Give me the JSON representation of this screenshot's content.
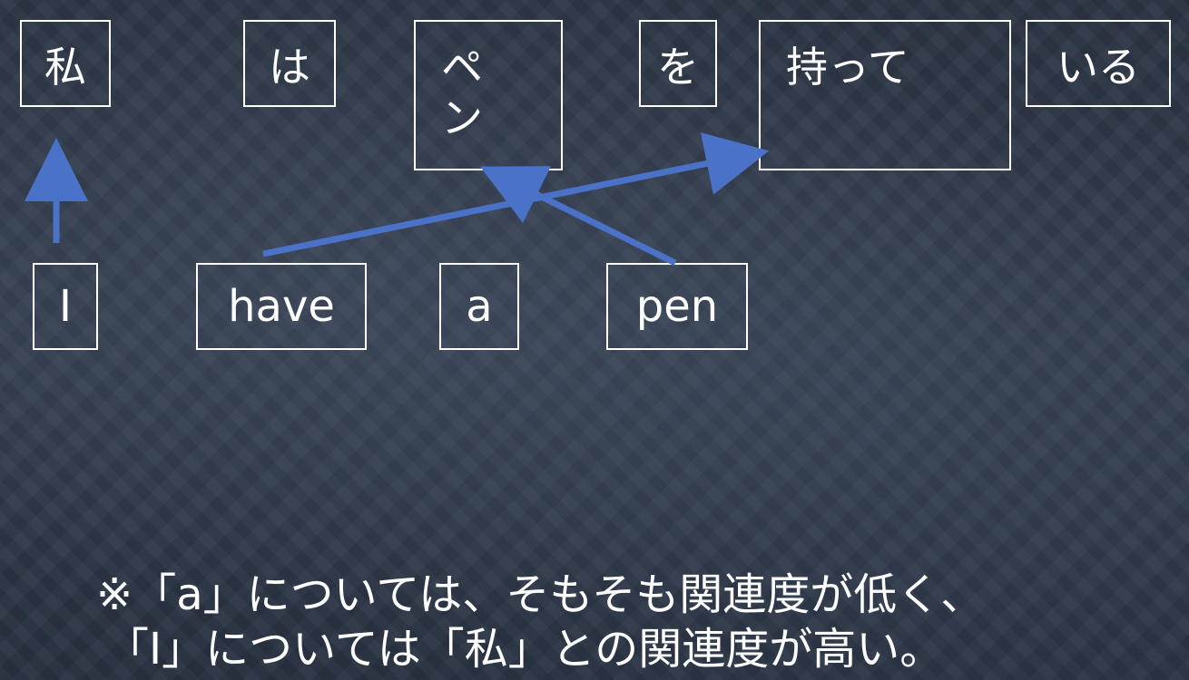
{
  "japanese_words": [
    "私",
    "は",
    "ペン",
    "を",
    "持って",
    "いる"
  ],
  "english_words": [
    "I",
    "have",
    "a",
    "pen"
  ],
  "note": {
    "line1": "※「a」については、そもそも関連度が低く、",
    "line2": "「I」については「私」との関連度が高い。"
  },
  "colors": {
    "arrow": "#4a72c6",
    "text": "#ffffff",
    "border": "#ffffff"
  }
}
